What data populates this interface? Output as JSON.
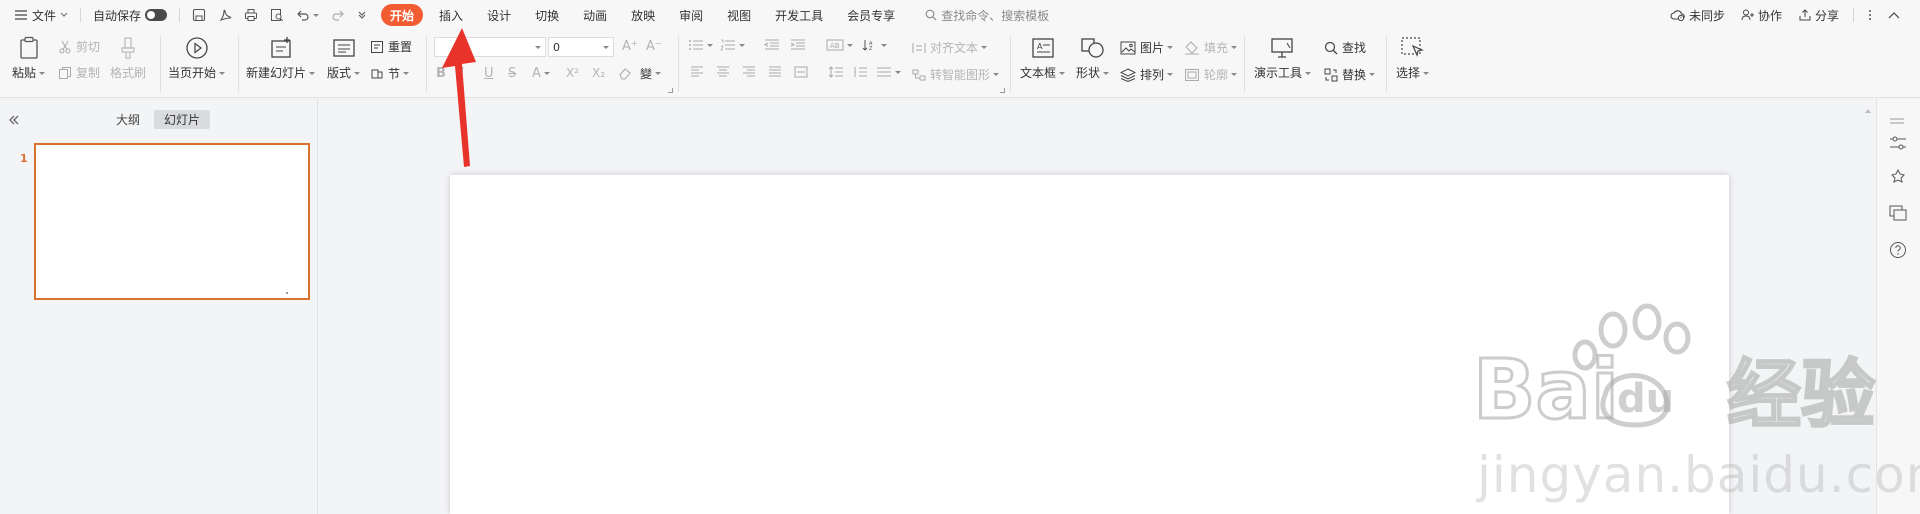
{
  "menubar": {
    "file": "文件",
    "autosave": "自动保存",
    "tabs": [
      "开始",
      "插入",
      "设计",
      "切换",
      "动画",
      "放映",
      "审阅",
      "视图",
      "开发工具",
      "会员专享"
    ],
    "search_placeholder": "查找命令、搜索模板",
    "unsynced": "未同步",
    "collaborate": "协作",
    "share": "分享"
  },
  "ribbon": {
    "paste": "粘贴",
    "cut": "剪切",
    "copy": "复制",
    "format_painter": "格式刷",
    "from_current": "当页开始",
    "new_slide": "新建幻灯片",
    "layout": "版式",
    "section": "节",
    "reset": "重置",
    "font_size": "0",
    "align_text": "对齐文本",
    "smart_art": "转智能图形",
    "textbox": "文本框",
    "shape": "形状",
    "picture": "图片",
    "arrange": "排列",
    "fill": "填充",
    "outline": "轮廓",
    "presenter_tools": "演示工具",
    "find": "查找",
    "replace": "替换",
    "select": "选择"
  },
  "panel": {
    "outline_tab": "大纲",
    "slides_tab": "幻灯片",
    "slide_number": "1"
  },
  "watermark": {
    "brand_latin": "Bai",
    "brand_du": "du",
    "brand_cn": "经验",
    "url": "jingyan.baidu.com"
  },
  "colors": {
    "accent": "#f25c33",
    "selection": "#d9722f",
    "arrow": "#e8332b"
  }
}
